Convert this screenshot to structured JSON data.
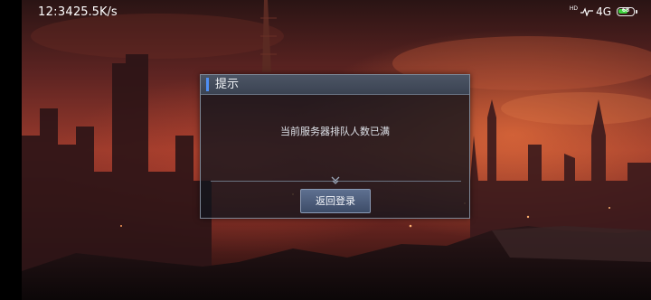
{
  "status_bar": {
    "time": "12:34",
    "net_speed": "25.5K/s",
    "hd_label": "HD",
    "network_type": "4G",
    "battery_level": "68",
    "battery_fill_fraction": 0.68
  },
  "dialog": {
    "title": "提示",
    "message": "当前服务器排队人数已满",
    "button_label": "返回登录"
  },
  "colors": {
    "accent": "#4f8ff5",
    "battery": "#3dd13d"
  }
}
